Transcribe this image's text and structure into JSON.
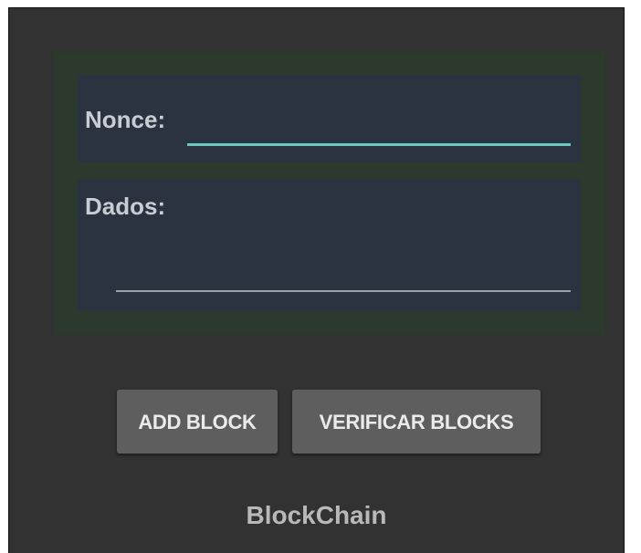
{
  "form": {
    "nonce_label": "Nonce:",
    "nonce_value": "",
    "dados_label": "Dados:",
    "dados_value": ""
  },
  "actions": {
    "add_block_label": "ADD BLOCK",
    "verify_blocks_label": "VERIFICAR BLOCKS"
  },
  "footer": {
    "title": "BlockChain"
  },
  "colors": {
    "background": "#323232",
    "card": "#2b3a2d",
    "field_panel": "#2b3340",
    "accent_underline": "#6ac8bd",
    "button": "#5e5e5e"
  }
}
